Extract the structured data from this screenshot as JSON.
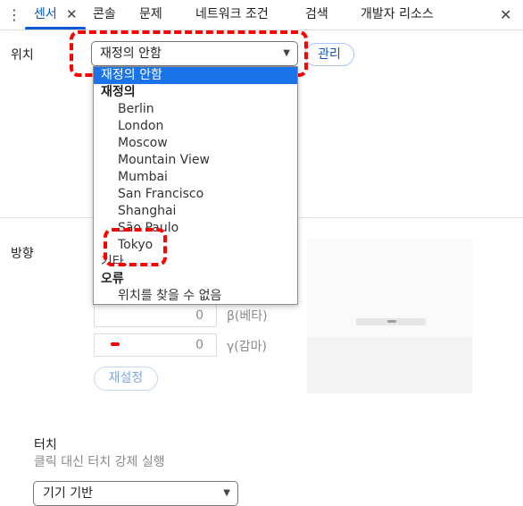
{
  "tabs": [
    {
      "label": "센서"
    },
    {
      "label": "콘솔"
    },
    {
      "label": "문제"
    },
    {
      "label": "네트워크 조건"
    },
    {
      "label": "검색"
    },
    {
      "label": "개발자 리소스"
    }
  ],
  "icons": {
    "menu": "kebab-menu-icon",
    "close": "close-icon",
    "dropdown_arrow": "triangle-down-icon"
  },
  "location": {
    "label": "위치",
    "selected": "재정의 안함",
    "manage_label": "관리",
    "dropdown": {
      "selected_item": "재정의 안함",
      "group_override": "재정의",
      "options": [
        "Berlin",
        "London",
        "Moscow",
        "Mountain View",
        "Mumbai",
        "San Francisco",
        "Shanghai",
        "São Paulo",
        "Tokyo"
      ],
      "other": "기타...",
      "group_error": "오류",
      "error_option": "위치를 찾을 수 없음"
    }
  },
  "orientation": {
    "label": "방향",
    "beta_value": "0",
    "beta_label": "β(베타)",
    "gamma_value": "0",
    "gamma_label": "γ(감마)",
    "reset_label": "재설정"
  },
  "touch": {
    "label": "터치",
    "description": "클릭 대신 터치 강제 실행",
    "selected": "기기 기반"
  },
  "colors": {
    "accent": "#0b57d0",
    "highlight": "#1a73e8",
    "annotation": "#ff0000"
  }
}
